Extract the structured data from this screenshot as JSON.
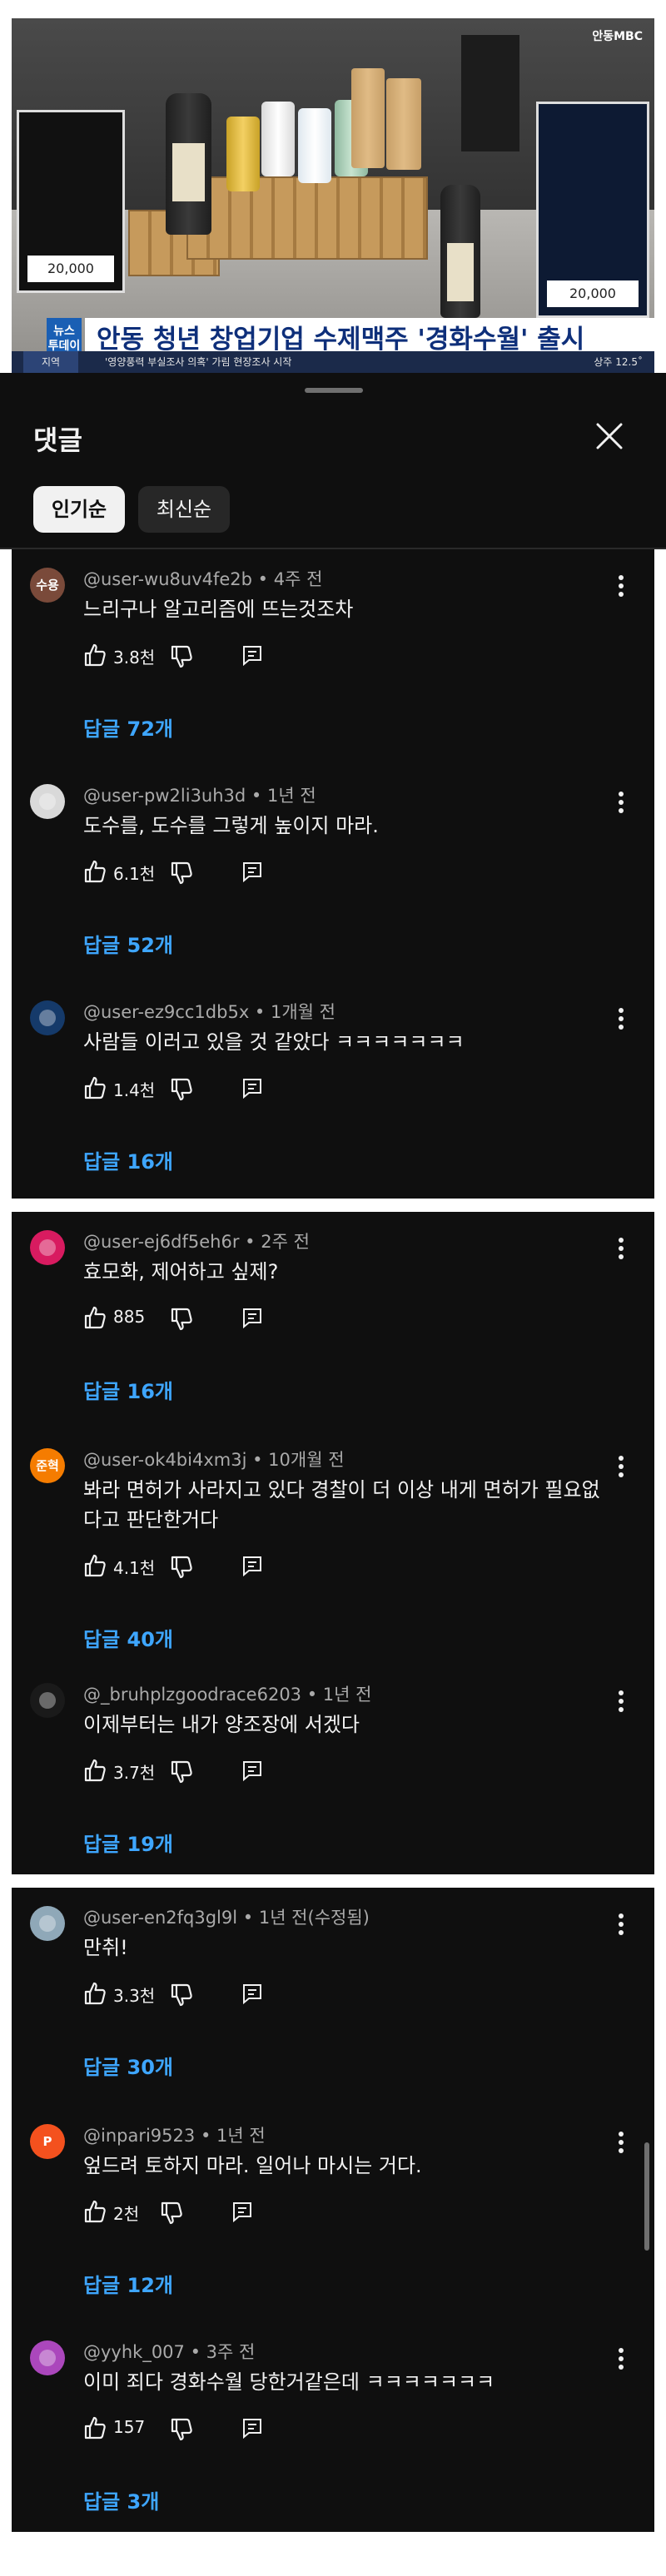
{
  "video": {
    "channel_logo": "안동MBC",
    "poster_price_left": "20,000",
    "poster_price_right": "20,000",
    "news_tag": "뉴스 투데이",
    "headline": "안동 청년 창업기업 수제맥주 '경화수월' 출시",
    "ticker_region": "지역",
    "ticker_text": "'영양풍력 부실조사 의혹' 가림 현장조사 시작",
    "ticker_weather": "상주 12.5˚"
  },
  "sheet": {
    "title": "댓글",
    "sort_popular": "인기순",
    "sort_newest": "최신순"
  },
  "comments": [
    {
      "avatar_text": "수용",
      "avatar_color": "#7a4a3a",
      "author": "@user-wu8uv4fe2b",
      "time": "4주 전",
      "text": "느리구나 알고리즘에 뜨는것조차",
      "likes": "3.8천",
      "replies": "답글 72개"
    },
    {
      "avatar_text": "",
      "avatar_color": "#d9d9d9",
      "author": "@user-pw2li3uh3d",
      "time": "1년 전",
      "text": "도수를, 도수를 그렇게 높이지 마라.",
      "likes": "6.1천",
      "replies": "답글 52개"
    },
    {
      "avatar_text": "",
      "avatar_color": "#153a6a",
      "author": "@user-ez9cc1db5x",
      "time": "1개월 전",
      "text": "사람들 이러고 있을 것 같았다 ㅋㅋㅋㅋㅋㅋㅋ",
      "likes": "1.4천",
      "replies": "답글 16개"
    },
    {
      "avatar_text": "",
      "avatar_color": "#d81b60",
      "author": "@user-ej6df5eh6r",
      "time": "2주 전",
      "text": "효모화, 제어하고 싶제?",
      "likes": "885",
      "replies": "답글 16개"
    },
    {
      "avatar_text": "준혁",
      "avatar_color": "#f57c00",
      "author": "@user-ok4bi4xm3j",
      "time": "10개월 전",
      "text": "봐라 면허가 사라지고 있다 경찰이 더 이상 내게 면허가 필요없다고 판단한거다",
      "likes": "4.1천",
      "replies": "답글 40개"
    },
    {
      "avatar_text": "",
      "avatar_color": "#1a1a1a",
      "author": "@_bruhplzgoodrace6203",
      "time": "1년 전",
      "text": "이제부터는 내가 양조장에 서겠다",
      "likes": "3.7천",
      "replies": "답글 19개"
    },
    {
      "avatar_text": "",
      "avatar_color": "#8fa8b8",
      "author": "@user-en2fq3gl9l",
      "time": "1년 전(수정됨)",
      "text": "만취!",
      "likes": "3.3천",
      "replies": "답글 30개"
    },
    {
      "avatar_text": "P",
      "avatar_color": "#f4511e",
      "author": "@inpari9523",
      "time": "1년 전",
      "text": "엎드려 토하지 마라. 일어나 마시는 거다.",
      "likes": "2천",
      "replies": "답글 12개"
    },
    {
      "avatar_text": "",
      "avatar_color": "#ab47bc",
      "author": "@yyhk_007",
      "time": "3주 전",
      "text": "이미 죄다 경화수월 당한거같은데 ㅋㅋㅋㅋㅋㅋㅋ",
      "likes": "157",
      "replies": "답글 3개"
    }
  ]
}
